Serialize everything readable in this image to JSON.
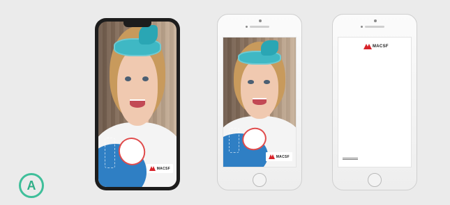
{
  "badge": {
    "label": "A"
  },
  "phones": {
    "selfie_x": {
      "sticker_text": "",
      "logo_word": "MACSF"
    },
    "selfie_8": {
      "sticker_text": "",
      "logo_word": "MACSF"
    },
    "frame_8": {
      "logo_word": "MACSF"
    }
  },
  "colors": {
    "background": "#ebebeb",
    "badge": "#3fbf9a",
    "brand_red": "#d8232a",
    "headband": "#3fb8c4",
    "blue_shape": "#2f7fc4"
  },
  "icons": [
    "macsf-logo",
    "home-button"
  ]
}
